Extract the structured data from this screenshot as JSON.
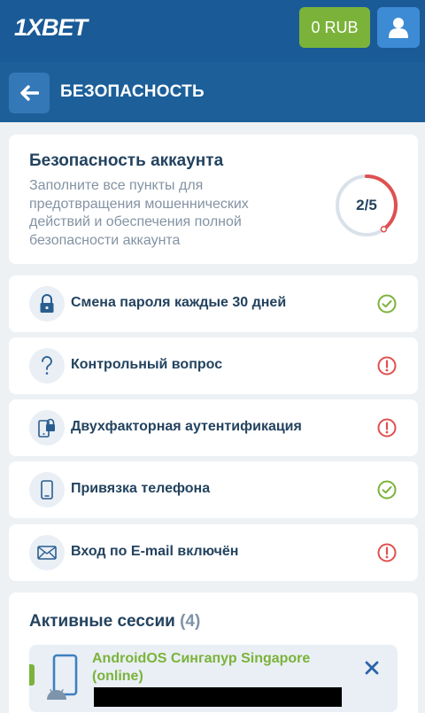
{
  "header": {
    "logo_text": "1XBET",
    "balance_label": "0 RUB",
    "profile_icon": "user-icon"
  },
  "titlebar": {
    "back_icon": "arrow-left-icon",
    "title": "БЕЗОПАСНОСТЬ"
  },
  "security": {
    "title": "Безопасность аккаунта",
    "description": "Заполните все пункты для предотвращения мошеннических действий и обеспечения полной безопасности аккаунта",
    "progress_label": "2/5",
    "progress_fraction": 0.4
  },
  "items": [
    {
      "label": "Смена пароля каждые 30 дней",
      "icon": "lock-icon",
      "status": "done"
    },
    {
      "label": "Контрольный вопрос",
      "icon": "question-icon",
      "status": "warning"
    },
    {
      "label": "Двухфакторная аутентификация",
      "icon": "two-factor-icon",
      "status": "warning"
    },
    {
      "label": "Привязка телефона",
      "icon": "phone-icon",
      "status": "done"
    },
    {
      "label": "Вход по E-mail включён",
      "icon": "envelope-icon",
      "status": "warning"
    }
  ],
  "sessions": {
    "title": "Активные сессии",
    "count": "(4)",
    "items": [
      {
        "name": "AndroidOS Сингапур Singapore (online)",
        "icon": "android-device-icon"
      }
    ]
  },
  "colors": {
    "header_bg": "#1a5a96",
    "accent_green": "#7bb33a",
    "accent_blue": "#3d8bd4",
    "status_ok": "#7bb33a",
    "status_warn": "#e05050",
    "text_dark": "#23435f",
    "text_muted": "#8393a3"
  }
}
